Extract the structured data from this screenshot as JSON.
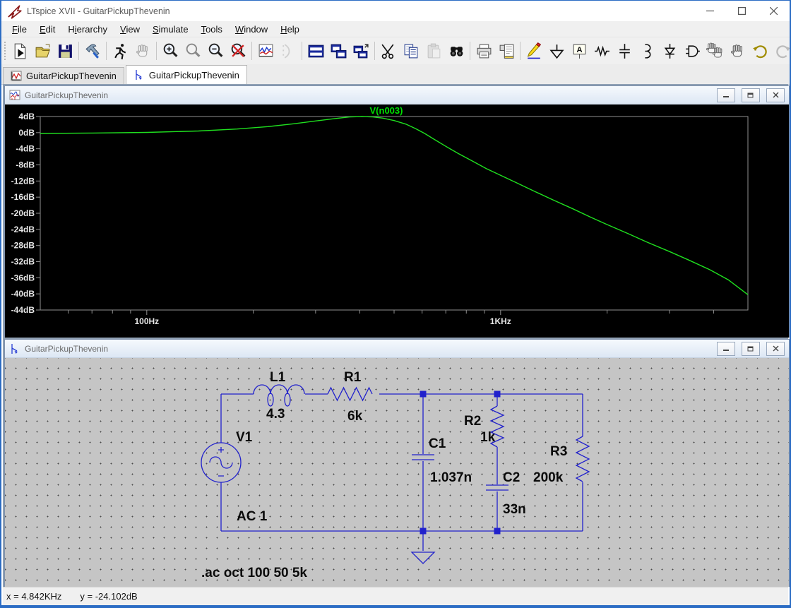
{
  "window": {
    "title": "LTspice XVII - GuitarPickupThevenin"
  },
  "menu": {
    "items": [
      {
        "label": "File",
        "u": 0
      },
      {
        "label": "Edit",
        "u": 0
      },
      {
        "label": "Hierarchy",
        "u": 1
      },
      {
        "label": "View",
        "u": 0
      },
      {
        "label": "Simulate",
        "u": 0
      },
      {
        "label": "Tools",
        "u": 0
      },
      {
        "label": "Window",
        "u": 0
      },
      {
        "label": "Help",
        "u": 0
      }
    ]
  },
  "toolbar": {
    "buttons": [
      {
        "name": "new-schematic-icon"
      },
      {
        "name": "open-icon"
      },
      {
        "name": "save-icon"
      },
      {
        "sep": true
      },
      {
        "name": "control-panel-icon"
      },
      {
        "sep": true
      },
      {
        "name": "run-icon"
      },
      {
        "name": "halt-icon",
        "disabled": true
      },
      {
        "sep": true
      },
      {
        "name": "zoom-in-icon"
      },
      {
        "name": "zoom-back-icon",
        "disabled": true
      },
      {
        "name": "zoom-out-icon"
      },
      {
        "name": "zoom-fit-icon"
      },
      {
        "sep": true
      },
      {
        "name": "plot-settings-icon"
      },
      {
        "name": "spice-netlist-icon",
        "disabled": true
      },
      {
        "sep": true
      },
      {
        "name": "tile-horizontal-icon"
      },
      {
        "name": "tile-vertical-icon"
      },
      {
        "name": "cascade-icon"
      },
      {
        "sep": true
      },
      {
        "name": "cut-icon"
      },
      {
        "name": "copy-icon"
      },
      {
        "name": "paste-icon",
        "disabled": true
      },
      {
        "name": "find-icon"
      },
      {
        "sep": true
      },
      {
        "name": "print-icon"
      },
      {
        "name": "print-preview-icon"
      },
      {
        "sep": true
      },
      {
        "name": "wire-icon"
      },
      {
        "name": "ground-icon"
      },
      {
        "name": "label-net-icon"
      },
      {
        "name": "resistor-icon"
      },
      {
        "name": "capacitor-icon"
      },
      {
        "name": "inductor-icon"
      },
      {
        "name": "diode-icon"
      },
      {
        "name": "component-icon"
      },
      {
        "name": "move-icon"
      },
      {
        "name": "drag-icon"
      },
      {
        "name": "undo-icon"
      },
      {
        "name": "redo-icon",
        "disabled": true
      },
      {
        "name": "text-icon"
      }
    ]
  },
  "tabs": [
    {
      "label": "GuitarPickupThevenin",
      "icon": "waveform-tab-icon",
      "active": false
    },
    {
      "label": "GuitarPickupThevenin",
      "icon": "schematic-tab-icon",
      "active": true
    }
  ],
  "windows": {
    "waveform": {
      "title": "GuitarPickupThevenin"
    },
    "schematic": {
      "title": "GuitarPickupThevenin"
    }
  },
  "chart_data": {
    "type": "line",
    "x_scale": "log",
    "xlim": [
      50,
      5000
    ],
    "ylim": [
      -44,
      4
    ],
    "y_tick_step": 4,
    "y_unit": "dB",
    "xticks_major": [
      {
        "value": 100,
        "label": "100Hz"
      },
      {
        "value": 1000,
        "label": "1KHz"
      }
    ],
    "xticks_minor": [
      60,
      70,
      80,
      90,
      200,
      300,
      400,
      500,
      600,
      700,
      800,
      900,
      2000,
      3000,
      4000
    ],
    "bg_color": "#000000",
    "frame_color": "#8f8f8f",
    "tick_label_color": "#e8e8e8",
    "legend_position": "top-center",
    "series": [
      {
        "name": "V(n003)",
        "color": "#1fdf1f",
        "label_color": "#00e100",
        "points": [
          [
            50,
            -0.2
          ],
          [
            70,
            -0.1
          ],
          [
            100,
            0.05
          ],
          [
            140,
            0.4
          ],
          [
            180,
            0.9
          ],
          [
            220,
            1.5
          ],
          [
            260,
            2.2
          ],
          [
            300,
            2.9
          ],
          [
            340,
            3.5
          ],
          [
            375,
            3.9
          ],
          [
            405,
            4.0
          ],
          [
            435,
            3.9
          ],
          [
            465,
            3.6
          ],
          [
            500,
            3.0
          ],
          [
            540,
            2.1
          ],
          [
            575,
            1.0
          ],
          [
            610,
            -0.2
          ],
          [
            650,
            -1.7
          ],
          [
            700,
            -3.4
          ],
          [
            760,
            -5.2
          ],
          [
            830,
            -7.0
          ],
          [
            910,
            -8.9
          ],
          [
            1000,
            -10.6
          ],
          [
            1100,
            -12.3
          ],
          [
            1250,
            -14.6
          ],
          [
            1400,
            -16.6
          ],
          [
            1600,
            -18.9
          ],
          [
            1800,
            -21.0
          ],
          [
            2000,
            -22.8
          ],
          [
            2300,
            -25.1
          ],
          [
            2600,
            -27.2
          ],
          [
            3000,
            -29.5
          ],
          [
            3400,
            -31.6
          ],
          [
            3900,
            -34.0
          ],
          [
            4400,
            -36.5
          ],
          [
            5000,
            -40.2
          ]
        ]
      }
    ]
  },
  "schematic": {
    "wire_color": "#2121cc",
    "text_color": "#0a0a0a",
    "directive": ".ac oct 100 50 5k",
    "components": {
      "V1": {
        "ref": "V1",
        "value": "AC 1"
      },
      "L1": {
        "ref": "L1",
        "value": "4.3"
      },
      "R1": {
        "ref": "R1",
        "value": "6k"
      },
      "C1": {
        "ref": "C1",
        "value": "1.037n"
      },
      "R2": {
        "ref": "R2",
        "value": "1k"
      },
      "C2": {
        "ref": "C2",
        "value": "33n"
      },
      "R3": {
        "ref": "R3",
        "value": "200k"
      }
    }
  },
  "statusbar": {
    "x_text": "x = 4.842KHz",
    "y_text": "y = -24.102dB"
  }
}
